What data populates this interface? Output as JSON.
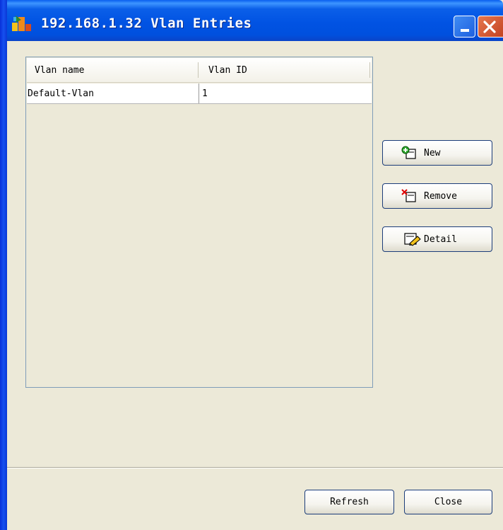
{
  "window": {
    "title": "192.168.1.32 Vlan Entries",
    "app_icon": "app-logo-icon",
    "minimize_icon": "minimize-icon",
    "close_icon": "close-icon",
    "accent_color": "#0153e3"
  },
  "table": {
    "columns": [
      "Vlan name",
      "Vlan ID"
    ],
    "rows": [
      {
        "name": "Default-Vlan",
        "id": "1"
      }
    ]
  },
  "actions": {
    "new_label": "New",
    "new_icon": "new-document-icon",
    "remove_label": "Remove",
    "remove_icon": "remove-document-icon",
    "detail_label": "Detail",
    "detail_icon": "edit-detail-icon"
  },
  "footer": {
    "refresh_label": "Refresh",
    "close_label": "Close"
  }
}
